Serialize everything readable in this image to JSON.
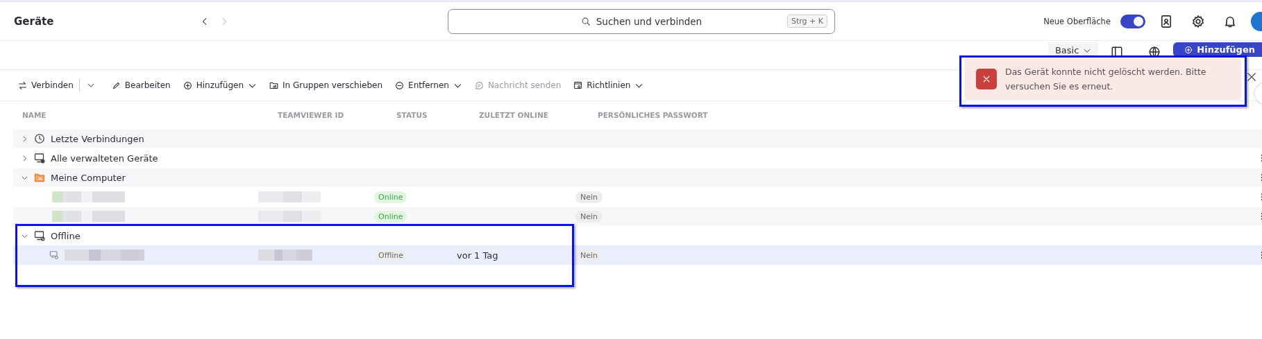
{
  "header": {
    "title": "Geräte",
    "search": {
      "placeholder": "Suchen und verbinden",
      "shortcut": "Strg + K"
    },
    "new_ui": {
      "label": "Neue Oberfläche",
      "on": true
    }
  },
  "view_bar": {
    "view": "Basic",
    "add_button": "Hinzufügen"
  },
  "toolbar": [
    {
      "label": "Verbinden",
      "split": true,
      "dropdown": true,
      "disabled": false
    },
    {
      "label": "Bearbeiten",
      "split": false,
      "dropdown": false,
      "disabled": false
    },
    {
      "label": "Hinzufügen",
      "split": false,
      "dropdown": true,
      "disabled": false
    },
    {
      "label": "In Gruppen verschieben",
      "split": false,
      "dropdown": false,
      "disabled": false
    },
    {
      "label": "Entfernen",
      "split": false,
      "dropdown": true,
      "disabled": false
    },
    {
      "label": "Nachricht senden",
      "split": false,
      "dropdown": false,
      "disabled": true
    },
    {
      "label": "Richtlinien",
      "split": false,
      "dropdown": true,
      "disabled": false
    }
  ],
  "table": {
    "columns": [
      "NAME",
      "TEAMVIEWER ID",
      "STATUS",
      "ZULETZT ONLINE",
      "PERSÖNLICHES PASSWORT"
    ],
    "groups": [
      {
        "name": "Letzte Verbindungen",
        "expanded": false,
        "menu": false,
        "highlighted": false
      },
      {
        "name": "Alle verwalteten Geräte",
        "expanded": false,
        "menu": true,
        "highlighted": false
      },
      {
        "name": "Meine Computer",
        "expanded": true,
        "menu": true,
        "highlighted": false,
        "children": [
          {
            "status": "Online",
            "online": true,
            "password": "Nein",
            "selected": false,
            "menu": true
          },
          {
            "status": "Online",
            "online": true,
            "password": "Nein",
            "selected": false,
            "menu": true
          }
        ]
      },
      {
        "name": "Offline",
        "expanded": true,
        "menu": false,
        "highlighted": true,
        "children": [
          {
            "status": "Offline",
            "online": false,
            "last_online": "vor 1 Tag",
            "password": "Nein",
            "selected": true,
            "menu": true
          }
        ]
      }
    ]
  },
  "toast": {
    "message": "Das Gerät konnte nicht gelöscht werden. Bitte versuchen Sie es erneut.",
    "highlighted": true
  }
}
